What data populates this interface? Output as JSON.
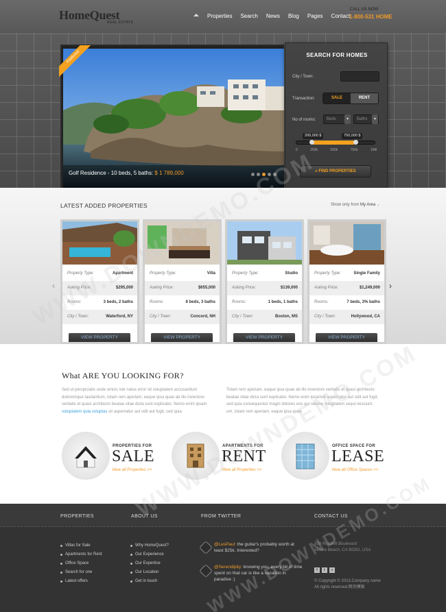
{
  "header": {
    "logo": "HomeQuest",
    "logo_sub": "REAL ESTATE",
    "nav": [
      "Properties",
      "Search",
      "News",
      "Blog",
      "Pages",
      "Contact"
    ],
    "call_label": "CALL US NOW",
    "phone": "1-800-531 HOME"
  },
  "slider": {
    "badge": "Featured",
    "caption_text": "Golf Residence - 10 beds, 5 baths:",
    "caption_price": "$ 1 789,000",
    "dots": 5,
    "active_dot": 2
  },
  "search": {
    "title": "SEARCH FOR HOMES",
    "city_label": "City / Town:",
    "transaction_label": "Transaction:",
    "sale": "SALE",
    "rent": "RENT",
    "rooms_label": "No of rooms:",
    "beds_placeholder": "Beds",
    "baths_placeholder": "Baths",
    "min_tag": "200,000 $",
    "max_tag": "750,000 $",
    "ticks": [
      "0",
      "250k",
      "500k",
      "750k",
      "1Mil"
    ],
    "range_min_fraction": 0.2,
    "range_max_fraction": 0.75,
    "find_label": "FIND PROPERTIES"
  },
  "latest": {
    "title": "LATEST ADDED PROPERTIES",
    "area_prefix": "Show only from",
    "area_value": "My Area",
    "labels": {
      "type": "Property Type:",
      "price": "Asking Price:",
      "rooms": "Rooms:",
      "city": "City / Town:"
    },
    "view_label": "VIEW PROPERTY",
    "cards": [
      {
        "type": "Apartment",
        "price": "$295,000",
        "rooms": "3 beds, 2 baths",
        "city": "Waterford, NY"
      },
      {
        "type": "Villa",
        "price": "$655,000",
        "rooms": "6 beds, 3 baths",
        "city": "Concord, NH"
      },
      {
        "type": "Studio",
        "price": "$139,000",
        "rooms": "1 beds, 1 baths",
        "city": "Boston, MS"
      },
      {
        "type": "Single Family",
        "price": "$1,249,000",
        "rooms": "7 beds, 3% baths",
        "city": "Hollywood, CA"
      }
    ]
  },
  "looking": {
    "title": "What ARE YOU LOOKING FOR?",
    "para1_a": "Sed ut perspiciatis unde omnis iste natus error sit voluptatem accusantium doloremque laudantium, totam rem aperiam, eaque ipsa quae ab illo inventore veritatis et quasi architecto beatae vitae dicta sunt explicabo. Nemo enim ipsam",
    "para1_link": "voluptatem quia voluptas",
    "para1_b": "sit aspernatur aut odit aut fugit, sed quia",
    "para2": "Totam rem aperiam, eaque ipsa quae ab illo inventore veritatis et quasi architecto beatae vitae dicta sunt explicabo. Nemo enim ipsamsit aspernatur aut odit aut fugit, sed quia consequuntur magni dolores eos qui ratione voluptatem sequi nesciunt. um, totam rem aperiam, eaque ipsa quae",
    "categories": [
      {
        "for": "PROPERTIES FOR",
        "big": "SALE",
        "link": "View all Properties >>"
      },
      {
        "for": "APARTMENTS FOR",
        "big": "RENT",
        "link": "View all Properties >>"
      },
      {
        "for": "OFFICE SPACE FOR",
        "big": "LEASE",
        "link": "View all Office Spaces >>"
      }
    ]
  },
  "footer": {
    "headings": [
      "PROPERTIES",
      "ABOUT US",
      "FROM TWITTER",
      "CONTACT US"
    ],
    "properties": [
      "Villas for Sale",
      "Apartments for Rent",
      "Office Space",
      "Search for one",
      "Latest offers"
    ],
    "about": [
      "Why HomeQuest?",
      "Our Experience",
      "Our Expertise",
      "Our Location",
      "Get in touch"
    ],
    "tweets": [
      {
        "handle": "@LesPaul:",
        "text": "the guitar's probably worth at least $25k. Interested?"
      },
      {
        "handle": "@Serendipity:",
        "text": "knowing you, every bit of time spent on that car is like a vacation in paradise :)"
      }
    ],
    "address1": "509 Roadhill Boulevard",
    "address2": "Venice Beach, CA 90291, USA",
    "copyright": "© Copyright © 2013.Company name",
    "rights": "All rights reserved.网页模板"
  },
  "watermark": "WWW.DOWNDEMO.COM"
}
